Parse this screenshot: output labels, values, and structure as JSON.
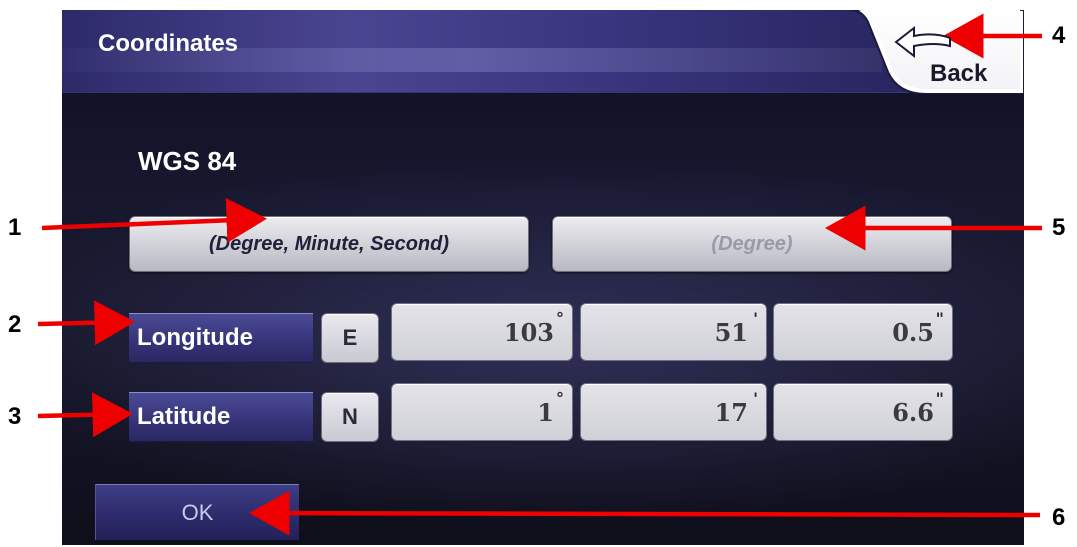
{
  "header": {
    "title": "Coordinates",
    "back_label": "Back"
  },
  "datum": {
    "label": "WGS 84"
  },
  "format_buttons": [
    {
      "label": "(Degree, Minute, Second)",
      "state": "active"
    },
    {
      "label": "(Degree)",
      "state": "inactive"
    }
  ],
  "longitude": {
    "label": "Longitude",
    "hemisphere": "E",
    "degrees": "103",
    "minutes": "51",
    "seconds": "0.5"
  },
  "latitude": {
    "label": "Latitude",
    "hemisphere": "N",
    "degrees": "1",
    "minutes": "17",
    "seconds": "6.6"
  },
  "units": {
    "degree": "°",
    "minute": "'",
    "second": "\""
  },
  "ok_label": "OK",
  "callouts": [
    "1",
    "2",
    "3",
    "4",
    "5",
    "6"
  ],
  "colors": {
    "callout_arrow": "#ee0000",
    "title_bar": "#3a3680",
    "background": "#151526"
  }
}
